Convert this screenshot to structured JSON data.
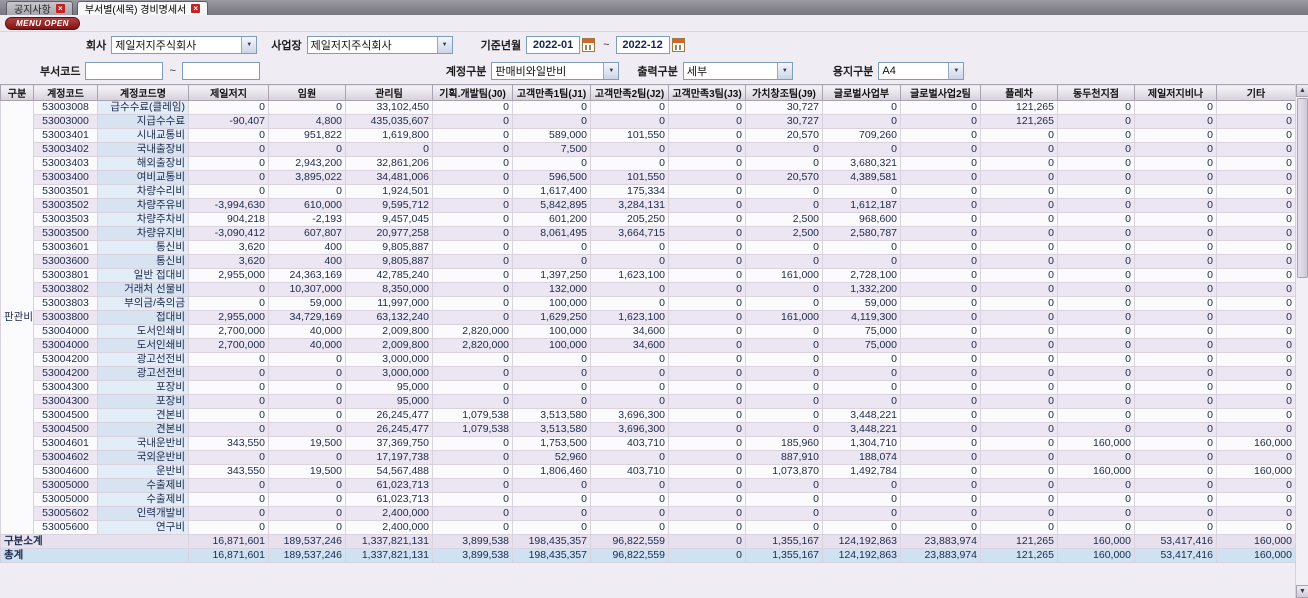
{
  "tabs": [
    {
      "label": "공지사항"
    },
    {
      "label": "부서별(세목) 경비명세서"
    }
  ],
  "menu_open_label": "MENU OPEN",
  "filters": {
    "company_label": "회사",
    "company_value": "제일저지주식회사",
    "workplace_label": "사업장",
    "workplace_value": "제일저지주식회사",
    "period_label": "기준년월",
    "period_from": "2022-01",
    "period_to": "2022-12",
    "tilde": "~",
    "dept_code_label": "부서코드",
    "dept_from": "",
    "dept_to": "",
    "account_type_label": "계정구분",
    "account_type_value": "판매비와일반비",
    "output_type_label": "출력구분",
    "output_type_value": "세부",
    "paper_label": "용지구분",
    "paper_value": "A4"
  },
  "table": {
    "headers": [
      "구분",
      "계정코드",
      "계정코드명",
      "제일저지",
      "임원",
      "관리팀",
      "기획.개발팀(J0)",
      "고객만족1팀(J1)",
      "고객만족2팀(J2)",
      "고객만족3팀(J3)",
      "가치창조팀(J9)",
      "글로벌사업부",
      "글로벌사업2팀",
      "플레차",
      "동두천지점",
      "제일저지비나",
      "기타"
    ],
    "group_label": "판관비",
    "rows": [
      {
        "code": "53003008",
        "name": "급수수료(클레임)",
        "values": [
          0,
          0,
          33102450,
          0,
          0,
          0,
          0,
          30727,
          0,
          0,
          121265,
          0,
          0,
          0
        ]
      },
      {
        "code": "53003000",
        "name": "지급수수료",
        "values": [
          -90407,
          4800,
          435035607,
          0,
          0,
          0,
          0,
          30727,
          0,
          0,
          121265,
          0,
          0,
          0
        ]
      },
      {
        "code": "53003401",
        "name": "시내교통비",
        "values": [
          0,
          951822,
          1619800,
          0,
          589000,
          101550,
          0,
          20570,
          709260,
          0,
          0,
          0,
          0,
          0
        ]
      },
      {
        "code": "53003402",
        "name": "국내출장비",
        "values": [
          0,
          0,
          0,
          0,
          7500,
          0,
          0,
          0,
          0,
          0,
          0,
          0,
          0,
          0
        ]
      },
      {
        "code": "53003403",
        "name": "해외출장비",
        "values": [
          0,
          2943200,
          32861206,
          0,
          0,
          0,
          0,
          0,
          3680321,
          0,
          0,
          0,
          0,
          0
        ]
      },
      {
        "code": "53003400",
        "name": "여비교통비",
        "values": [
          0,
          3895022,
          34481006,
          0,
          596500,
          101550,
          0,
          20570,
          4389581,
          0,
          0,
          0,
          0,
          0
        ]
      },
      {
        "code": "53003501",
        "name": "차량수리비",
        "values": [
          0,
          0,
          1924501,
          0,
          1617400,
          175334,
          0,
          0,
          0,
          0,
          0,
          0,
          0,
          0
        ]
      },
      {
        "code": "53003502",
        "name": "차량주유비",
        "values": [
          -3994630,
          610000,
          9595712,
          0,
          5842895,
          3284131,
          0,
          0,
          1612187,
          0,
          0,
          0,
          0,
          0
        ]
      },
      {
        "code": "53003503",
        "name": "차량주차비",
        "values": [
          904218,
          -2193,
          9457045,
          0,
          601200,
          205250,
          0,
          2500,
          968600,
          0,
          0,
          0,
          0,
          0
        ]
      },
      {
        "code": "53003500",
        "name": "차량유지비",
        "values": [
          -3090412,
          607807,
          20977258,
          0,
          8061495,
          3664715,
          0,
          2500,
          2580787,
          0,
          0,
          0,
          0,
          0
        ]
      },
      {
        "code": "53003601",
        "name": "통신비",
        "values": [
          3620,
          400,
          9805887,
          0,
          0,
          0,
          0,
          0,
          0,
          0,
          0,
          0,
          0,
          0
        ]
      },
      {
        "code": "53003600",
        "name": "통신비",
        "values": [
          3620,
          400,
          9805887,
          0,
          0,
          0,
          0,
          0,
          0,
          0,
          0,
          0,
          0,
          0
        ]
      },
      {
        "code": "53003801",
        "name": "일반 접대비",
        "values": [
          2955000,
          24363169,
          42785240,
          0,
          1397250,
          1623100,
          0,
          161000,
          2728100,
          0,
          0,
          0,
          0,
          0
        ]
      },
      {
        "code": "53003802",
        "name": "거래처 선물비",
        "values": [
          0,
          10307000,
          8350000,
          0,
          132000,
          0,
          0,
          0,
          1332200,
          0,
          0,
          0,
          0,
          0
        ]
      },
      {
        "code": "53003803",
        "name": "부의금/축의금",
        "values": [
          0,
          59000,
          11997000,
          0,
          100000,
          0,
          0,
          0,
          59000,
          0,
          0,
          0,
          0,
          0
        ]
      },
      {
        "code": "53003800",
        "name": "접대비",
        "values": [
          2955000,
          34729169,
          63132240,
          0,
          1629250,
          1623100,
          0,
          161000,
          4119300,
          0,
          0,
          0,
          0,
          0
        ]
      },
      {
        "code": "53004000",
        "name": "도서인쇄비",
        "values": [
          2700000,
          40000,
          2009800,
          2820000,
          100000,
          34600,
          0,
          0,
          75000,
          0,
          0,
          0,
          0,
          0
        ]
      },
      {
        "code": "53004000",
        "name": "도서인쇄비",
        "values": [
          2700000,
          40000,
          2009800,
          2820000,
          100000,
          34600,
          0,
          0,
          75000,
          0,
          0,
          0,
          0,
          0
        ]
      },
      {
        "code": "53004200",
        "name": "광고선전비",
        "values": [
          0,
          0,
          3000000,
          0,
          0,
          0,
          0,
          0,
          0,
          0,
          0,
          0,
          0,
          0
        ]
      },
      {
        "code": "53004200",
        "name": "광고선전비",
        "values": [
          0,
          0,
          3000000,
          0,
          0,
          0,
          0,
          0,
          0,
          0,
          0,
          0,
          0,
          0
        ]
      },
      {
        "code": "53004300",
        "name": "포장비",
        "values": [
          0,
          0,
          95000,
          0,
          0,
          0,
          0,
          0,
          0,
          0,
          0,
          0,
          0,
          0
        ]
      },
      {
        "code": "53004300",
        "name": "포장비",
        "values": [
          0,
          0,
          95000,
          0,
          0,
          0,
          0,
          0,
          0,
          0,
          0,
          0,
          0,
          0
        ]
      },
      {
        "code": "53004500",
        "name": "견본비",
        "values": [
          0,
          0,
          26245477,
          1079538,
          3513580,
          3696300,
          0,
          0,
          3448221,
          0,
          0,
          0,
          0,
          0
        ]
      },
      {
        "code": "53004500",
        "name": "견본비",
        "values": [
          0,
          0,
          26245477,
          1079538,
          3513580,
          3696300,
          0,
          0,
          3448221,
          0,
          0,
          0,
          0,
          0
        ]
      },
      {
        "code": "53004601",
        "name": "국내운반비",
        "values": [
          343550,
          19500,
          37369750,
          0,
          1753500,
          403710,
          0,
          185960,
          1304710,
          0,
          0,
          160000,
          0,
          160000
        ]
      },
      {
        "code": "53004602",
        "name": "국외운반비",
        "values": [
          0,
          0,
          17197738,
          0,
          52960,
          0,
          0,
          887910,
          188074,
          0,
          0,
          0,
          0,
          0
        ]
      },
      {
        "code": "53004600",
        "name": "운반비",
        "values": [
          343550,
          19500,
          54567488,
          0,
          1806460,
          403710,
          0,
          1073870,
          1492784,
          0,
          0,
          160000,
          0,
          160000
        ]
      },
      {
        "code": "53005000",
        "name": "수출제비",
        "values": [
          0,
          0,
          61023713,
          0,
          0,
          0,
          0,
          0,
          0,
          0,
          0,
          0,
          0,
          0
        ]
      },
      {
        "code": "53005000",
        "name": "수출제비",
        "values": [
          0,
          0,
          61023713,
          0,
          0,
          0,
          0,
          0,
          0,
          0,
          0,
          0,
          0,
          0
        ]
      },
      {
        "code": "53005602",
        "name": "인력개발비",
        "values": [
          0,
          0,
          2400000,
          0,
          0,
          0,
          0,
          0,
          0,
          0,
          0,
          0,
          0,
          0
        ]
      },
      {
        "code": "53005600",
        "name": "연구비",
        "values": [
          0,
          0,
          2400000,
          0,
          0,
          0,
          0,
          0,
          0,
          0,
          0,
          0,
          0,
          0
        ]
      }
    ],
    "subtotal": {
      "label": "구분소계",
      "values": [
        16871601,
        189537246,
        1337821131,
        3899538,
        198435357,
        96822559,
        0,
        1355167,
        124192863,
        23883974,
        121265,
        160000,
        53417416,
        160000
      ]
    },
    "total": {
      "label": "총계",
      "values": [
        16871601,
        189537246,
        1337821131,
        3899538,
        198435357,
        96822559,
        0,
        1355167,
        124192863,
        23883974,
        121265,
        160000,
        53417416,
        160000
      ]
    }
  }
}
